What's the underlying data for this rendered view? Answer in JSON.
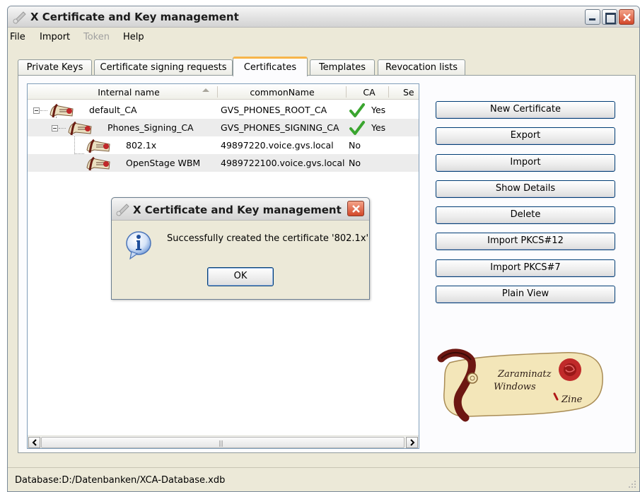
{
  "window": {
    "title": "X Certificate and Key management"
  },
  "menu": [
    {
      "label": "File",
      "enabled": true
    },
    {
      "label": "Import",
      "enabled": true
    },
    {
      "label": "Token",
      "enabled": false
    },
    {
      "label": "Help",
      "enabled": true
    }
  ],
  "tabs": [
    {
      "label": "Private Keys"
    },
    {
      "label": "Certificate signing requests"
    },
    {
      "label": "Certificates",
      "active": true
    },
    {
      "label": "Templates"
    },
    {
      "label": "Revocation lists"
    }
  ],
  "table": {
    "columns": [
      "Internal name",
      "commonName",
      "CA",
      "Se"
    ],
    "rows": [
      {
        "internal_name": "default_CA",
        "common_name": "GVS_PHONES_ROOT_CA",
        "ca": "Yes",
        "ca_checked": true
      },
      {
        "internal_name": "Phones_Signing_CA",
        "common_name": "GVS_PHONES_SIGNING_CA",
        "ca": "Yes",
        "ca_checked": true
      },
      {
        "internal_name": "802.1x",
        "common_name": "49897220.voice.gvs.local",
        "ca": "No",
        "ca_checked": false
      },
      {
        "internal_name": "OpenStage WBM",
        "common_name": "4989722100.voice.gvs.local",
        "ca": "No",
        "ca_checked": false
      }
    ],
    "scroll_grip": "|||"
  },
  "buttons": {
    "new_certificate": "New Certificate",
    "export": "Export",
    "import": "Import",
    "show_details": "Show Details",
    "delete": "Delete",
    "import_pkcs12": "Import PKCS#12",
    "import_pkcs7": "Import PKCS#7",
    "plain_view": "Plain View"
  },
  "logo": {
    "line1": "Zaraminatz",
    "line2": "Windows",
    "line3": "Zine"
  },
  "status": {
    "text": "Database:D:/Datenbanken/XCA-Database.xdb"
  },
  "dialog": {
    "title": "X Certificate and Key management",
    "message": "Successfully created the certificate '802.1x'",
    "ok_label": "OK"
  },
  "colors": {
    "tab_accent": "#f7b54a",
    "check": "#3aa52f",
    "close_red": "#d2472a",
    "info_blue": "#3a6fc8"
  }
}
